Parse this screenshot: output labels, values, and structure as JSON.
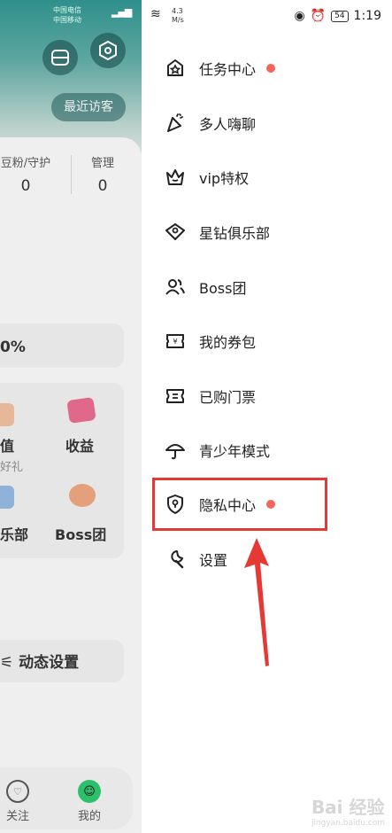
{
  "status_bar": {
    "carrier_1": "中国电信",
    "carrier_2": "中国移动",
    "network_speed": "4.3",
    "speed_unit": "M/s",
    "battery": "54",
    "time": "1:19"
  },
  "background": {
    "visitor_button": "最近访客",
    "stats": [
      {
        "label": "豆粉/守护",
        "value": "0"
      },
      {
        "label": "管理",
        "value": "0"
      }
    ],
    "percent": "0%",
    "grid": [
      {
        "label": "值",
        "sub": "好礼"
      },
      {
        "label": "收益"
      },
      {
        "label": "乐部"
      },
      {
        "label": "Boss团"
      }
    ],
    "dynamic_settings": "动态设置",
    "nav": [
      {
        "label": "关注"
      },
      {
        "label": "我的"
      }
    ]
  },
  "drawer": {
    "menu": [
      {
        "label": "任务中心",
        "icon": "star-box-icon",
        "dot": true
      },
      {
        "label": "多人嗨聊",
        "icon": "party-cone-icon",
        "dot": false
      },
      {
        "label": "vip特权",
        "icon": "crown-icon",
        "dot": false
      },
      {
        "label": "星钻俱乐部",
        "icon": "diamond-star-icon",
        "dot": false
      },
      {
        "label": "Boss团",
        "icon": "people-icon",
        "dot": false
      },
      {
        "label": "我的券包",
        "icon": "coupon-icon",
        "dot": false
      },
      {
        "label": "已购门票",
        "icon": "ticket-icon",
        "dot": false
      },
      {
        "label": "青少年模式",
        "icon": "umbrella-icon",
        "dot": false
      },
      {
        "label": "隐私中心",
        "icon": "shield-lock-icon",
        "dot": true
      },
      {
        "label": "设置",
        "icon": "wrench-icon",
        "dot": false
      }
    ],
    "accent_dot_color": "#f4665c",
    "highlight_color": "#e53935"
  },
  "watermark": {
    "text": "Bai 经验",
    "sub": "jingyan.baidu.com"
  }
}
